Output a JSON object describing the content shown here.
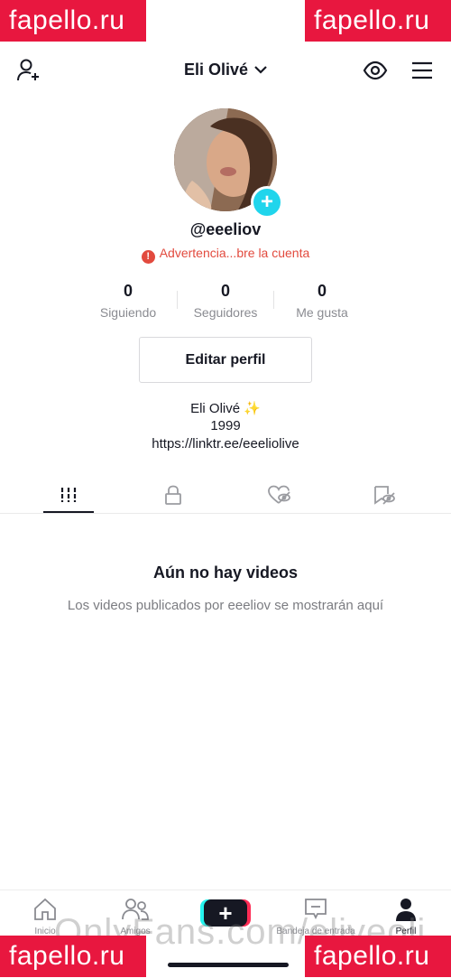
{
  "watermark": {
    "text": "fapello.ru",
    "bottom_text": "OnlyFans.com/eliveoli"
  },
  "header": {
    "title": "Eli Olivé",
    "add_friend_icon": "person-add-icon",
    "dropdown_icon": "chevron-down-icon",
    "view_icon": "eye-icon",
    "menu_icon": "hamburger-menu-icon"
  },
  "profile": {
    "username": "@eeeliov",
    "warning": "Advertencia...bre la cuenta",
    "warning_color": "#e24a3e",
    "plus_color": "#20d5ec"
  },
  "stats": [
    {
      "value": "0",
      "label": "Siguiendo"
    },
    {
      "value": "0",
      "label": "Seguidores"
    },
    {
      "value": "0",
      "label": "Me gusta"
    }
  ],
  "edit_button": "Editar perfil",
  "bio": {
    "line1": "Eli Olivé ✨",
    "line2": "1999",
    "link": "https://linktr.ee/eeeliolive"
  },
  "tabs": [
    "grid-icon",
    "lock-icon",
    "liked-heart-hidden-icon",
    "saved-hidden-icon"
  ],
  "empty_state": {
    "title": "Aún no hay videos",
    "subtitle": "Los videos publicados por eeeliov se mostrarán aquí"
  },
  "bottom_nav": {
    "items": [
      {
        "label": "Inicio",
        "icon": "home-icon"
      },
      {
        "label": "Amigos",
        "icon": "friends-icon"
      },
      {
        "label": "",
        "icon": "plus-icon"
      },
      {
        "label": "Bandeja de entrada",
        "icon": "inbox-icon"
      },
      {
        "label": "Perfil",
        "icon": "profile-icon"
      }
    ]
  }
}
